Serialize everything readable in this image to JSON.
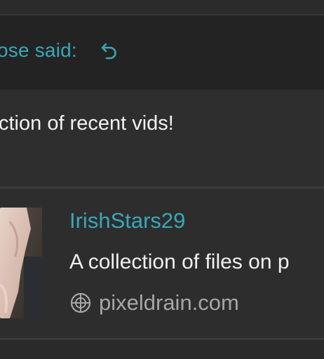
{
  "quote": {
    "author_line": "ose said:",
    "text": "ction of recent vids!"
  },
  "link_preview": {
    "title": "IrishStars29",
    "description": "A collection of files on p",
    "site": "pixeldrain.com"
  },
  "icons": {
    "jump": "undo-arrow-icon",
    "site": "globe-icon"
  },
  "colors": {
    "accent": "#3aa7b8",
    "background": "#2d2d2d",
    "quote_header_bg": "#232323",
    "text": "#f2f2f2",
    "muted": "#a6a6a6"
  }
}
